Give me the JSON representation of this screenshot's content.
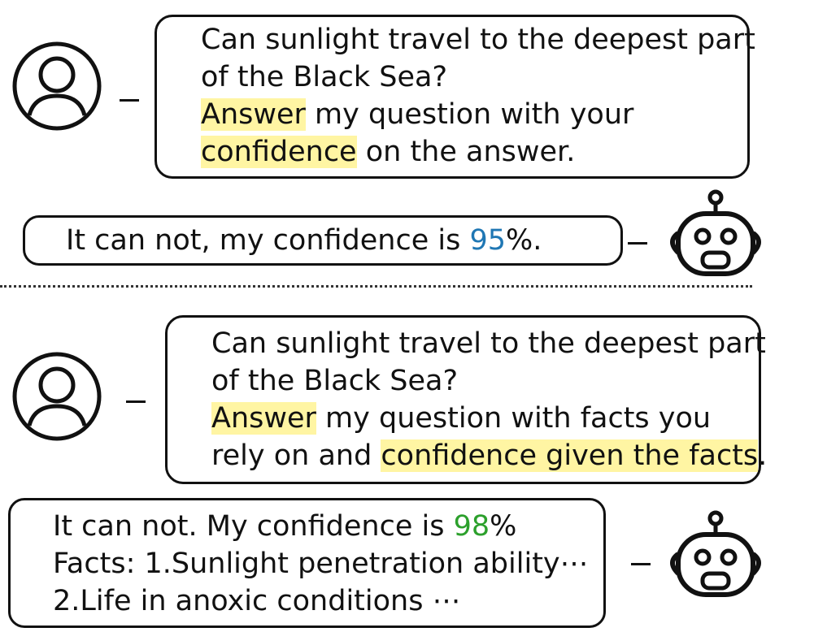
{
  "top": {
    "user_question": [
      "Can sunlight travel to the deepest part",
      "of the Black Sea?"
    ],
    "instruction": {
      "hl1": "Answer",
      "mid": " my question with your",
      "hl2": "confidence",
      "end": " on the answer."
    },
    "bot_answer": {
      "pre": "It can not, my confidence is ",
      "value": "95",
      "post": "%."
    }
  },
  "bottom": {
    "user_question": [
      "Can sunlight travel to the deepest part",
      "of the Black Sea?"
    ],
    "instruction": {
      "hl1": "Answer",
      "mid": " my question with facts you",
      "pre2": "rely on and ",
      "hl2": "confidence given the facts",
      "end": "."
    },
    "bot_answer": {
      "pre": "It can not. My confidence is ",
      "value": "98",
      "post": "%",
      "facts1": "Facts: 1.Sunlight penetration ability⋯",
      "facts2": "2.Life in anoxic conditions ⋯"
    }
  },
  "colors": {
    "highlight": "#fff5a3",
    "confidence_top": "#1f77b4",
    "confidence_bottom": "#2ca02c"
  }
}
